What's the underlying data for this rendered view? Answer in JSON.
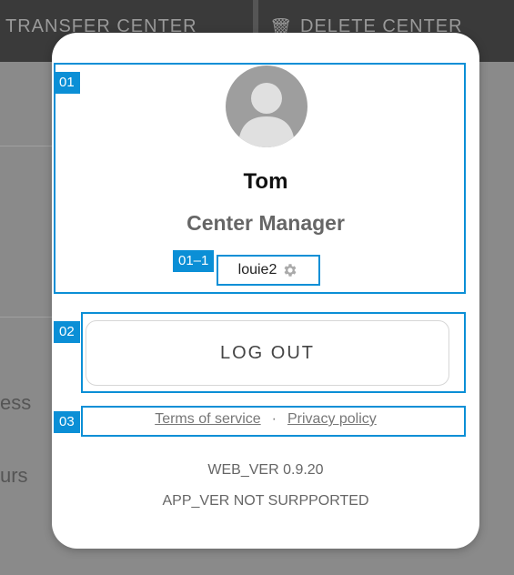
{
  "background": {
    "tabs": [
      {
        "label": "TRANSFER CENTER"
      },
      {
        "label": "DELETE CENTER"
      }
    ],
    "side_texts": [
      "ess",
      "urs"
    ]
  },
  "profile": {
    "name": "Tom",
    "role": "Center Manager",
    "user_id": "louie2"
  },
  "actions": {
    "logout_label": "LOG OUT"
  },
  "links": {
    "terms": "Terms of service",
    "separator": "·",
    "privacy": "Privacy policy"
  },
  "versions": {
    "web": "WEB_VER 0.9.20",
    "app": "APP_VER NOT SURPPORTED"
  },
  "annotations": {
    "a1": "01",
    "a1_1": "01–1",
    "a2": "02",
    "a3": "03"
  },
  "colors": {
    "annotation": "#0b8fd6",
    "overlay": "#8c8c8c"
  }
}
